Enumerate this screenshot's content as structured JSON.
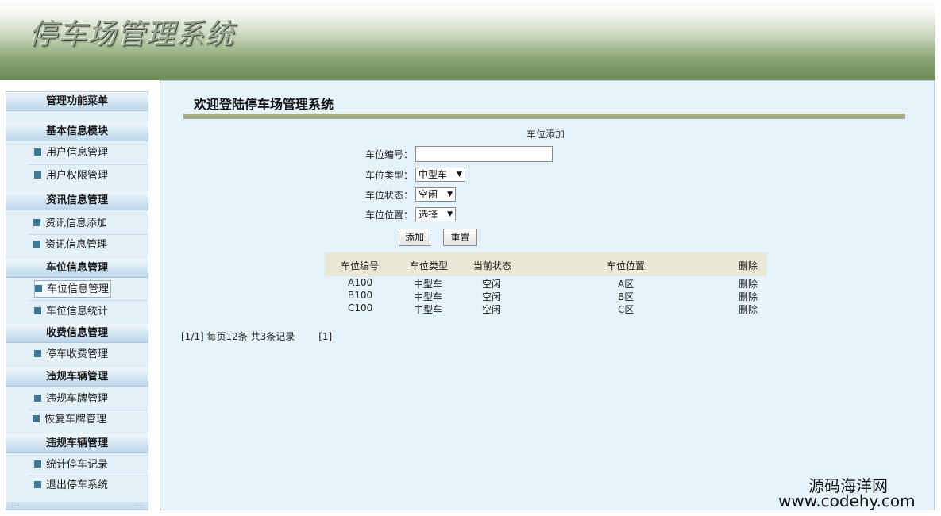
{
  "header": {
    "logo_text": "停车场管理系统"
  },
  "sidebar": {
    "main_title": "管理功能菜单",
    "sections": [
      {
        "title": "基本信息模块",
        "items": [
          "用户信息管理",
          "用户权限管理"
        ]
      },
      {
        "title": "资讯信息管理",
        "items": [
          "资讯信息添加",
          "资讯信息管理"
        ]
      },
      {
        "title": "车位信息管理",
        "items": [
          "车位信息管理",
          "车位信息统计"
        ]
      },
      {
        "title": "收费信息管理",
        "items": [
          "停车收费管理"
        ]
      },
      {
        "title": "违规车辆管理",
        "items": [
          "违规车牌管理",
          "恢复车牌管理"
        ]
      },
      {
        "title": "违规车辆管理",
        "items": [
          "统计停车记录",
          "退出停车系统"
        ]
      }
    ],
    "footer_left": "::::",
    "footer_right": "::::"
  },
  "main": {
    "welcome": "欢迎登陆停车场管理系统",
    "form": {
      "title": "车位添加",
      "number_label": "车位编号：",
      "number_value": "",
      "type_label": "车位类型：",
      "type_selected": "中型车",
      "status_label": "车位状态：",
      "status_selected": "空闲",
      "location_label": "车位位置：",
      "location_selected": "选择",
      "add_button": "添加",
      "reset_button": "重置"
    },
    "table": {
      "columns": [
        "车位编号",
        "车位类型",
        "当前状态",
        "车位位置",
        "删除"
      ],
      "rows": [
        [
          "A100",
          "中型车",
          "空闲",
          "A区",
          "删除"
        ],
        [
          "B100",
          "中型车",
          "空闲",
          "B区",
          "删除"
        ],
        [
          "C100",
          "中型车",
          "空闲",
          "C区",
          "删除"
        ]
      ]
    },
    "pager": {
      "summary": "[1/1] 每页12条 共3条记录",
      "pages": "[1]"
    }
  },
  "watermark": {
    "line1": "源码海洋网",
    "line2": "www.codehy.com"
  },
  "colors": {
    "accent_bar": "#a6ac85",
    "sidebar_bg": "#e4f0f8",
    "main_bg": "#e6f2f9",
    "bullet": "#3e7a98"
  }
}
